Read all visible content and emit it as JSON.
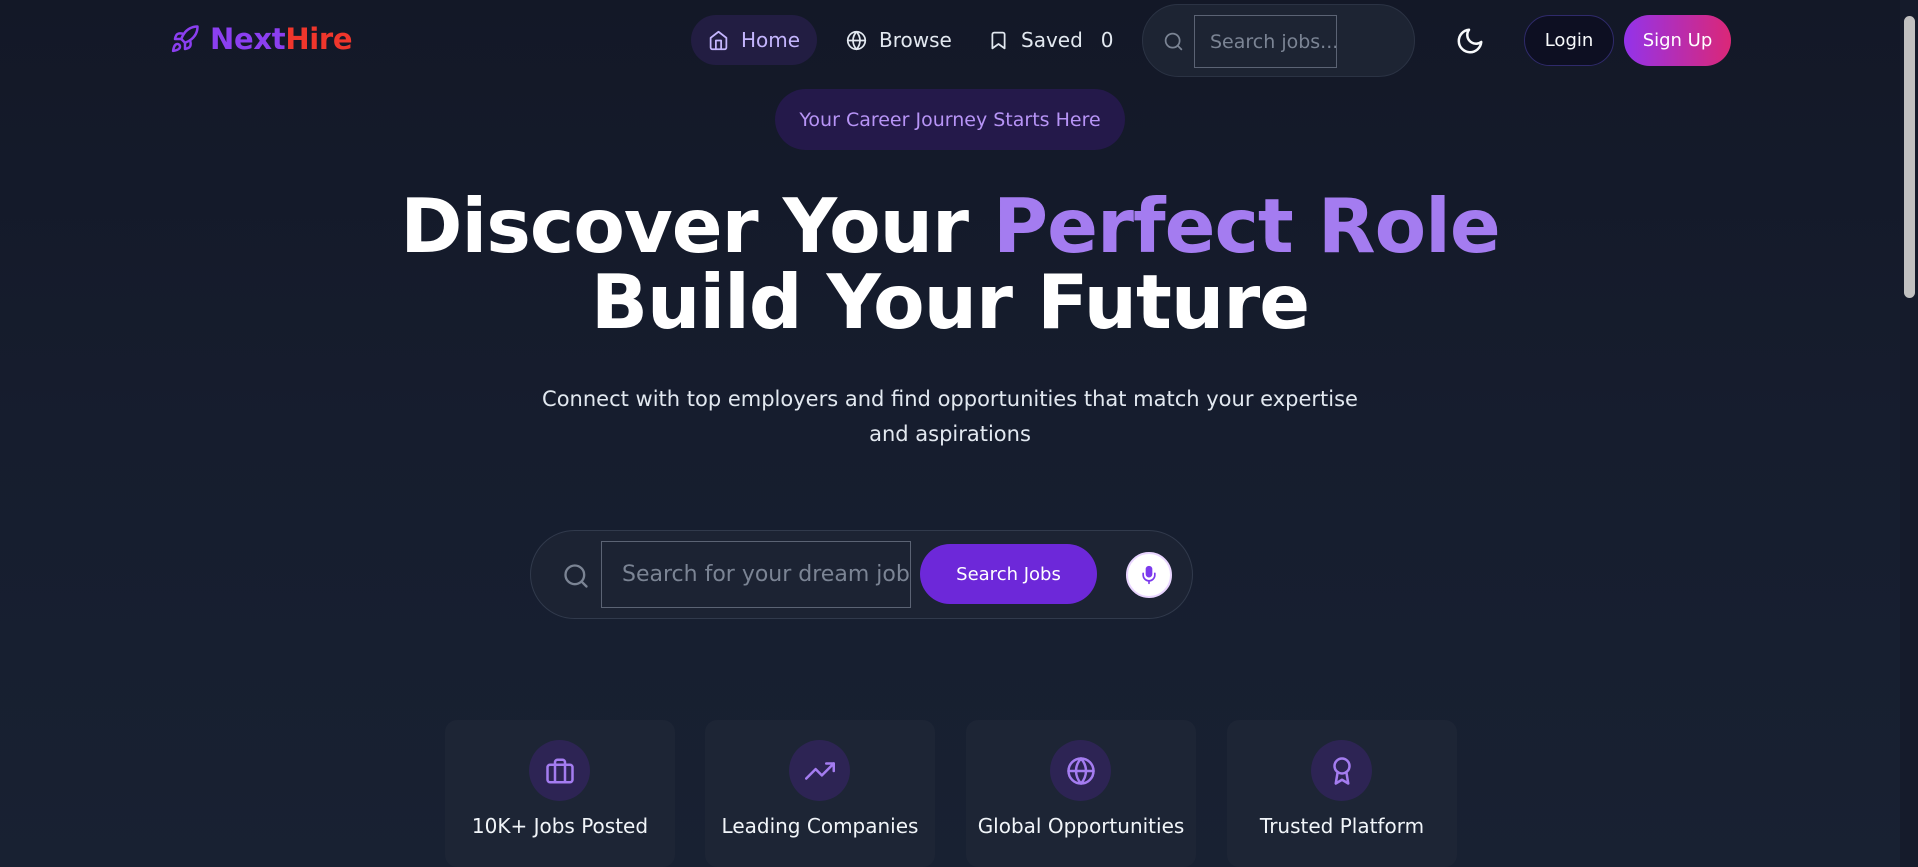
{
  "brand": {
    "part1": "Next",
    "part2": "Hire",
    "icon": "rocket-icon"
  },
  "nav": {
    "items": [
      {
        "label": "Home",
        "icon": "home-icon",
        "active": true
      },
      {
        "label": "Browse",
        "icon": "globe-icon"
      },
      {
        "label": "Saved",
        "icon": "bookmark-icon",
        "count": "0"
      }
    ],
    "search_placeholder": "Search jobs..."
  },
  "auth": {
    "login_label": "Login",
    "signup_label": "Sign Up"
  },
  "hero": {
    "tagline": "Your Career Journey Starts Here",
    "title_part1": "Discover Your ",
    "title_accent": "Perfect Role",
    "title_line2": "Build Your Future",
    "subtitle": "Connect with top employers and find opportunities that match your expertise and aspirations"
  },
  "search": {
    "placeholder": "Search for your dream job...",
    "button_label": "Search Jobs"
  },
  "features": [
    {
      "label": "10K+ Jobs Posted",
      "icon": "briefcase-icon"
    },
    {
      "label": "Leading Companies",
      "icon": "trending-up-icon"
    },
    {
      "label": "Global Opportunities",
      "icon": "globe-icon"
    },
    {
      "label": "Trusted Platform",
      "icon": "award-icon"
    }
  ],
  "colors": {
    "accent": "#a47cf0",
    "brand_purple": "#8b3ff0",
    "brand_red": "#f0362c",
    "button_purple": "#6d28d9",
    "signup_gradient_start": "#9333ea",
    "signup_gradient_end": "#db2777",
    "background": "#141a2a"
  }
}
